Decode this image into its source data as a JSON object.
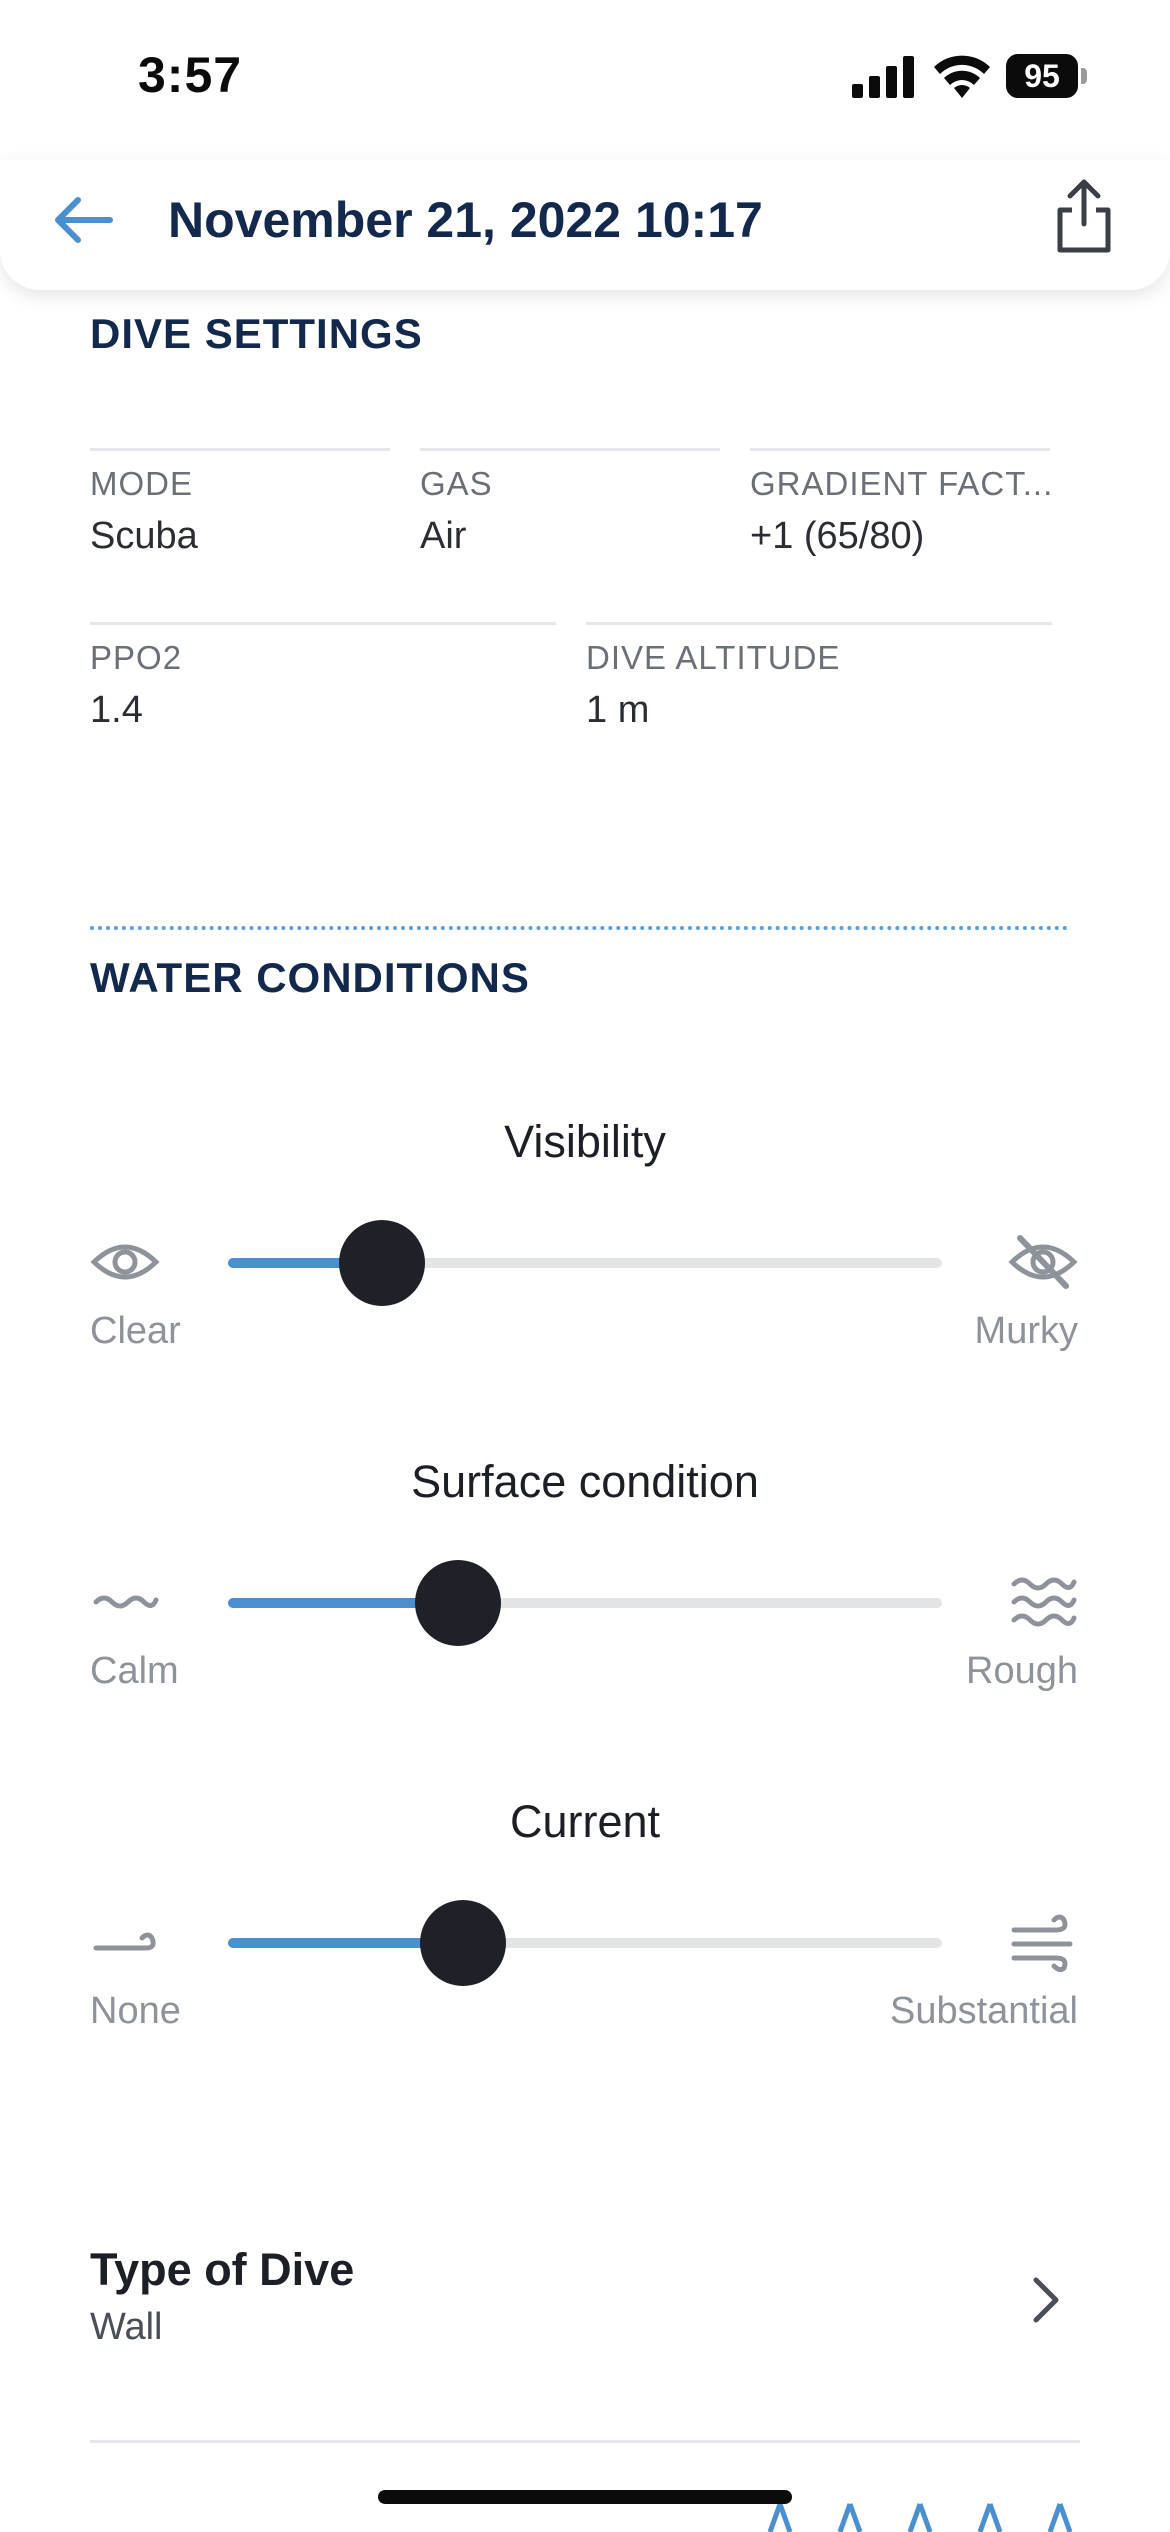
{
  "status": {
    "time": "3:57",
    "battery": "95"
  },
  "header": {
    "title": "November 21, 2022 10:17"
  },
  "dive_settings": {
    "title": "DIVE SETTINGS",
    "fields": [
      {
        "label": "MODE",
        "value": "Scuba"
      },
      {
        "label": "GAS",
        "value": "Air"
      },
      {
        "label": "GRADIENT FACT...",
        "value": "+1 (65/80)"
      },
      {
        "label": "PPO2",
        "value": "1.4"
      },
      {
        "label": "DIVE ALTITUDE",
        "value": "1 m"
      }
    ]
  },
  "water_conditions": {
    "title": "WATER CONDITIONS",
    "sliders": [
      {
        "title": "Visibility",
        "min_label": "Clear",
        "max_label": "Murky",
        "min_icon": "eye-icon",
        "max_icon": "eye-off-icon",
        "level": 0.215
      },
      {
        "title": "Surface condition",
        "min_label": "Calm",
        "max_label": "Rough",
        "min_icon": "calm-wave-icon",
        "max_icon": "rough-waves-icon",
        "level": 0.322
      },
      {
        "title": "Current",
        "min_label": "None",
        "max_label": "Substantial",
        "min_icon": "light-current-icon",
        "max_icon": "strong-current-icon",
        "level": 0.329
      }
    ]
  },
  "type_of_dive": {
    "title": "Type of Dive",
    "value": "Wall"
  },
  "colors": {
    "accent": "#4a90d1",
    "heading": "#12294d",
    "thumb": "#1e2128",
    "track": "#e3e4e6"
  }
}
